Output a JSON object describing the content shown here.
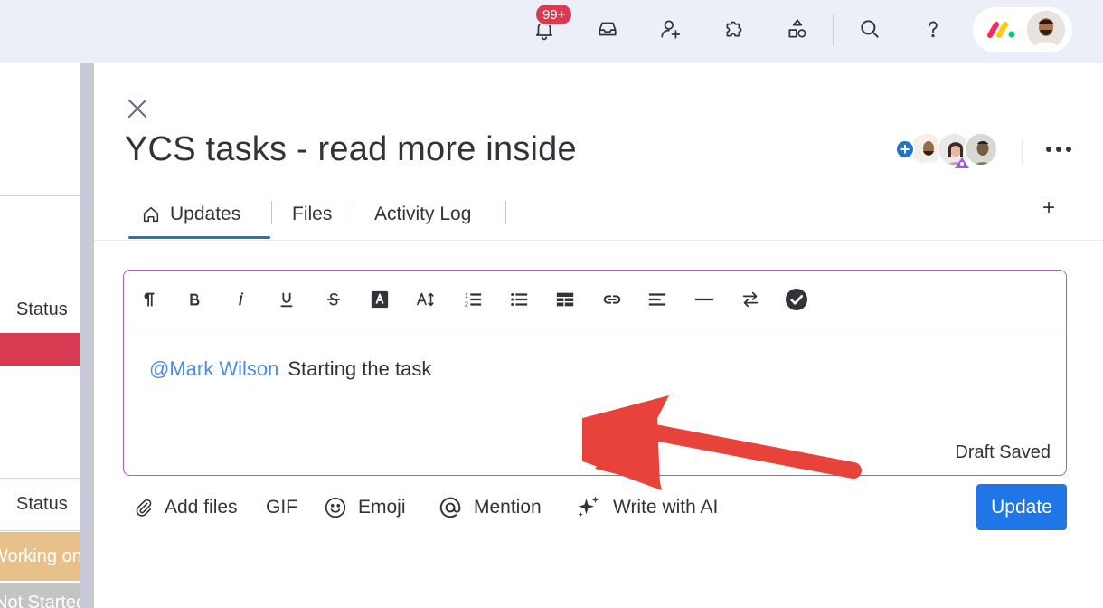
{
  "topbar": {
    "notifications_badge": "99+",
    "icons": [
      "bell-icon",
      "inbox-icon",
      "invite-member-icon",
      "apps-puzzle-icon",
      "shapes-icon",
      "search-icon",
      "help-icon"
    ],
    "brand_colors": [
      "#fb275d",
      "#ffcb00",
      "#00ca72"
    ]
  },
  "board": {
    "status_label_1": "Status",
    "status_label_2": "Status",
    "cell_red_color": "#d83a52",
    "cell_working": "Working on it",
    "cell_working_color": "#e8c08a",
    "cell_not_started": "Not Started",
    "cell_not_started_color": "#c4c4c4"
  },
  "panel": {
    "title": "YCS tasks - read more inside",
    "tabs": [
      {
        "label": "Updates",
        "icon": "home-icon",
        "active": true
      },
      {
        "label": "Files"
      },
      {
        "label": "Activity Log"
      }
    ],
    "add_tab": "+",
    "editor": {
      "mention": "@Mark Wilson",
      "text": "Starting the task",
      "draft_status": "Draft Saved",
      "border_color": "#a25ddc",
      "toolbar_icons": [
        "paragraph-icon",
        "bold-icon",
        "italic-icon",
        "underline-icon",
        "strikethrough-icon",
        "text-color-icon",
        "font-size-icon",
        "numbered-list-icon",
        "bullet-list-icon",
        "table-icon",
        "link-icon",
        "align-icon",
        "divider-icon",
        "direction-icon",
        "checklist-icon"
      ]
    },
    "actions": {
      "add_files": "Add files",
      "gif": "GIF",
      "emoji": "Emoji",
      "mention": "Mention",
      "write_ai": "Write with AI",
      "update": "Update"
    }
  },
  "annotation": {
    "arrow_color": "#e8433a"
  }
}
